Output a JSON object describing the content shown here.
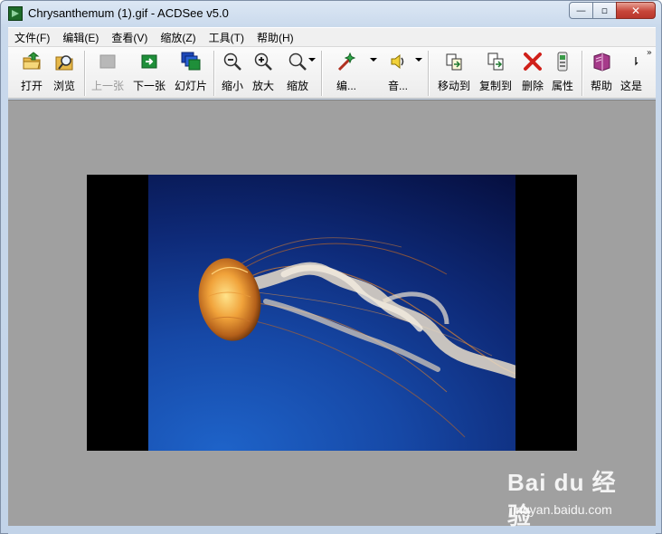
{
  "window": {
    "title": "Chrysanthemum (1).gif - ACDSee v5.0",
    "minimize_glyph": "—",
    "maximize_glyph": "▫",
    "close_glyph": "✕"
  },
  "menu": [
    "文件(F)",
    "编辑(E)",
    "查看(V)",
    "缩放(Z)",
    "工具(T)",
    "帮助(H)"
  ],
  "toolbar": {
    "open": "打开",
    "browse": "浏览",
    "previous": "上一张",
    "next": "下一张",
    "slideshow": "幻灯片",
    "zoom_out": "缩小",
    "zoom_in": "放大",
    "zoom": "缩放",
    "edit": "编...",
    "audio": "音...",
    "move_to": "移动到",
    "copy_to": "复制到",
    "delete": "删除",
    "properties": "属性",
    "help": "帮助",
    "whats_this": "这是",
    "overflow": "»"
  },
  "watermark": {
    "logo": "Bai du 经验",
    "url": "jingyan.baidu.com"
  },
  "colors": {
    "viewer_bg": "#a0a0a0",
    "image_border": "#000000",
    "close_button": "#c7463a"
  }
}
